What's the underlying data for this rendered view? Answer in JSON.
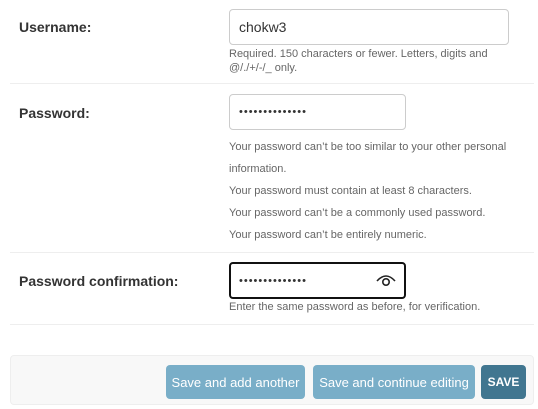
{
  "username": {
    "label": "Username:",
    "value": "chokw3",
    "help": "Required. 150 characters or fewer. Letters, digits and @/./+/-/_ only."
  },
  "password": {
    "label": "Password:",
    "value": "••••••••••••••",
    "help": [
      "Your password can’t be too similar to your other personal information.",
      "Your password must contain at least 8 characters.",
      "Your password can’t be a commonly used password.",
      "Your password can’t be entirely numeric."
    ]
  },
  "password_confirmation": {
    "label": "Password confirmation:",
    "value": "••••••••••••••",
    "help": "Enter the same password as before, for verification.",
    "toggle_icon": "eye-icon"
  },
  "actions": {
    "save_add_another": "Save and add another",
    "save_continue": "Save and continue editing",
    "save": "SAVE"
  },
  "colors": {
    "primary_button": "#79aec8",
    "default_button": "#417690",
    "help_text": "#666666"
  }
}
